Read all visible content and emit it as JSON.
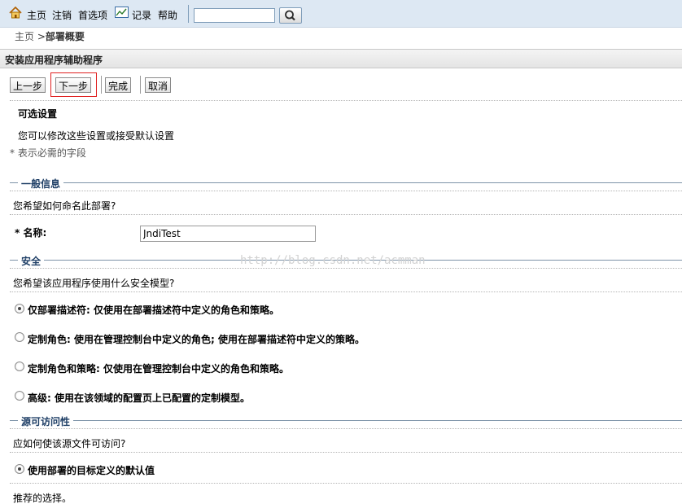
{
  "topbar": {
    "nav_home": "主页",
    "nav_logout": "注销",
    "nav_preferences": "首选项",
    "nav_record": "记录",
    "nav_help": "帮助",
    "search_value": "",
    "icons": {
      "home": "home-icon",
      "record": "chart-icon",
      "search": "magnifier-icon"
    }
  },
  "breadcrumb": {
    "home": "主页",
    "separator": ">",
    "current": "部署概要"
  },
  "page_title": "安装应用程序辅助程序",
  "toolbar": {
    "back": "上一步",
    "next": "下一步",
    "finish": "完成",
    "cancel": "取消"
  },
  "optional": {
    "heading": "可选设置",
    "desc": "您可以修改这些设置或接受默认设置",
    "required_note": "* 表示必需的字段"
  },
  "general": {
    "title": "一般信息",
    "question": "您希望如何命名此部署?",
    "name_label": "* 名称:",
    "name_value": "JndiTest"
  },
  "security": {
    "title": "安全",
    "question": "您希望该应用程序使用什么安全模型?",
    "options": [
      {
        "label": "仅部署描述符: 仅使用在部署描述符中定义的角色和策略。",
        "checked": true
      },
      {
        "label": "定制角色: 使用在管理控制台中定义的角色; 使用在部署描述符中定义的策略。",
        "checked": false
      },
      {
        "label": "定制角色和策略: 仅使用在管理控制台中定义的角色和策略。",
        "checked": false
      },
      {
        "label": "高级: 使用在该领域的配置页上已配置的定制模型。",
        "checked": false
      }
    ]
  },
  "source": {
    "title": "源可访问性",
    "question": "应如何使该源文件可访问?",
    "option": "使用部署的目标定义的默认值",
    "recommend": "推荐的选择。"
  },
  "watermark": "http://blog.csdn.net/acmman",
  "colors": {
    "topbar_bg": "#dde8f3",
    "section_title": "#1f3f66",
    "highlight_border": "#e02020"
  }
}
